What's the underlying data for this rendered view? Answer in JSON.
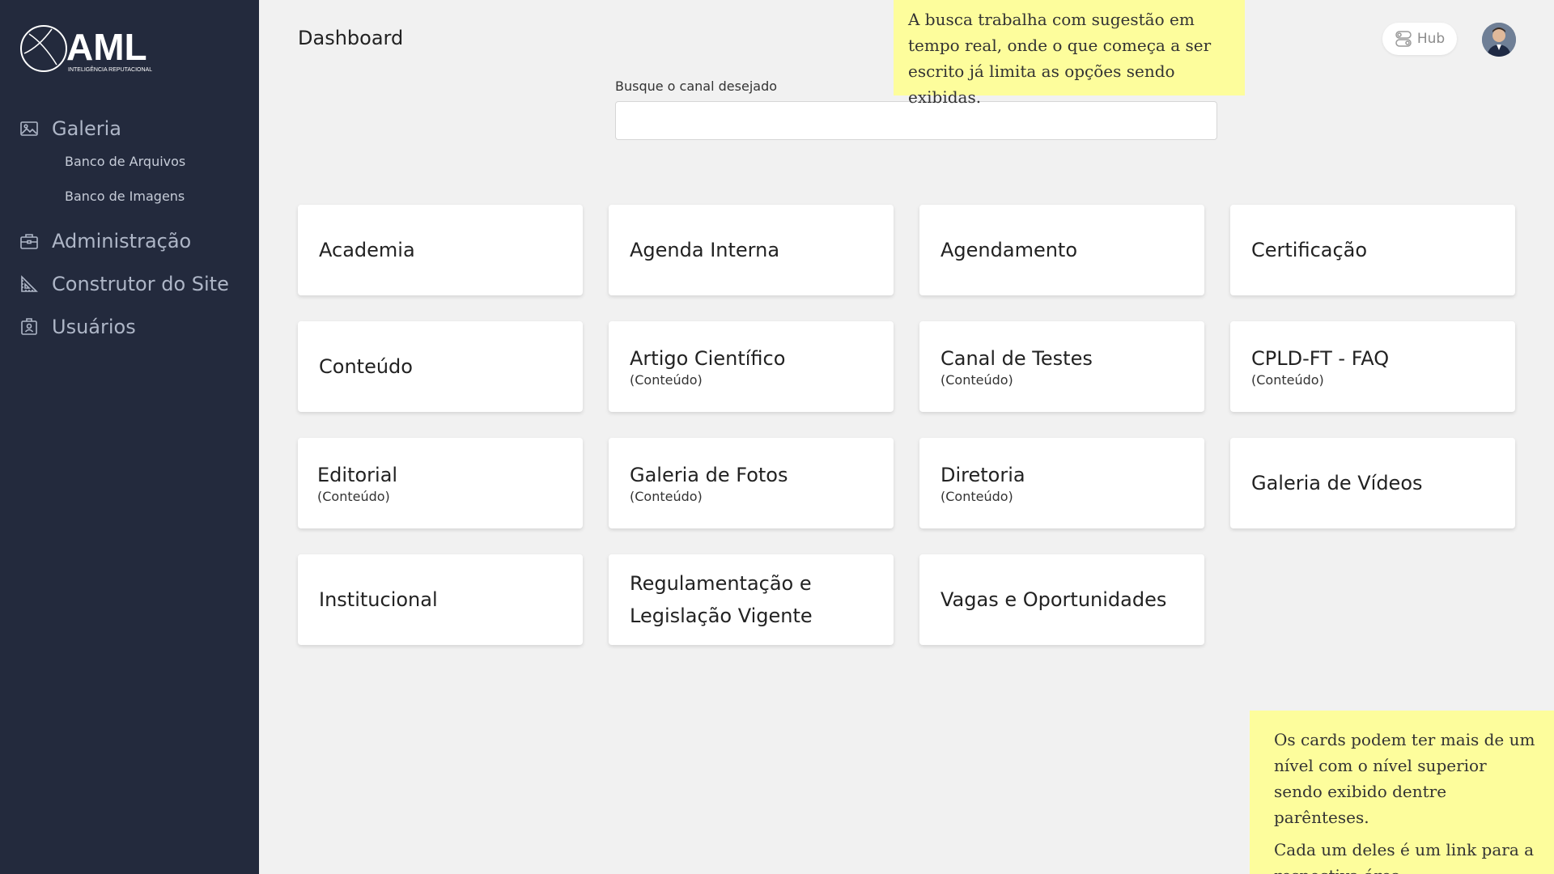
{
  "logo": {
    "text": "AML",
    "tagline": "INTELIGÊNCIA REPUTACIONAL"
  },
  "sidebar": {
    "items": [
      {
        "label": "Galeria",
        "icon": "image-icon",
        "children": [
          "Banco de Arquivos",
          "Banco de Imagens"
        ]
      },
      {
        "label": "Administração",
        "icon": "briefcase-icon"
      },
      {
        "label": "Construtor do Site",
        "icon": "ruler-triangle-icon"
      },
      {
        "label": "Usuários",
        "icon": "id-badge-icon"
      }
    ]
  },
  "header": {
    "title": "Dashboard",
    "hub_label": "Hub",
    "hub_icon": "toggle-icon"
  },
  "search": {
    "label": "Busque o canal desejado",
    "value": "",
    "placeholder": ""
  },
  "cards": [
    {
      "title": "Academia",
      "parent": ""
    },
    {
      "title": "Agenda Interna",
      "parent": ""
    },
    {
      "title": "Agendamento",
      "parent": ""
    },
    {
      "title": "Certificação",
      "parent": ""
    },
    {
      "title": "Conteúdo",
      "parent": ""
    },
    {
      "title": "Artigo Científico",
      "parent": "(Conteúdo)"
    },
    {
      "title": "Canal de Testes",
      "parent": "(Conteúdo)"
    },
    {
      "title": "CPLD-FT - FAQ",
      "parent": "(Conteúdo)"
    },
    {
      "title": "Editorial",
      "parent": "(Conteúdo)"
    },
    {
      "title": "Galeria de Fotos",
      "parent": "(Conteúdo)"
    },
    {
      "title": "Diretoria",
      "parent": "(Conteúdo)"
    },
    {
      "title": "Galeria de Vídeos",
      "parent": ""
    },
    {
      "title": "Institucional",
      "parent": ""
    },
    {
      "title": "Regulamentação e Legislação Vigente",
      "parent": ""
    },
    {
      "title": "Vagas e Oportunidades",
      "parent": ""
    }
  ],
  "annotations": {
    "search_note": "A busca trabalha com sugestão em tempo real, onde o que começa a ser escrito já limita as opções sendo exibidas.",
    "cards_note_1": "Os cards podem ter mais de um nível com o nível superior sendo exibido dentre parênteses.",
    "cards_note_2": "Cada um deles é um link para a respectiva área"
  },
  "colors": {
    "sidebar_bg": "#232a3d",
    "page_bg": "#f1f1f1",
    "card_bg": "#ffffff",
    "annotation_bg": "#fdfd9c"
  }
}
